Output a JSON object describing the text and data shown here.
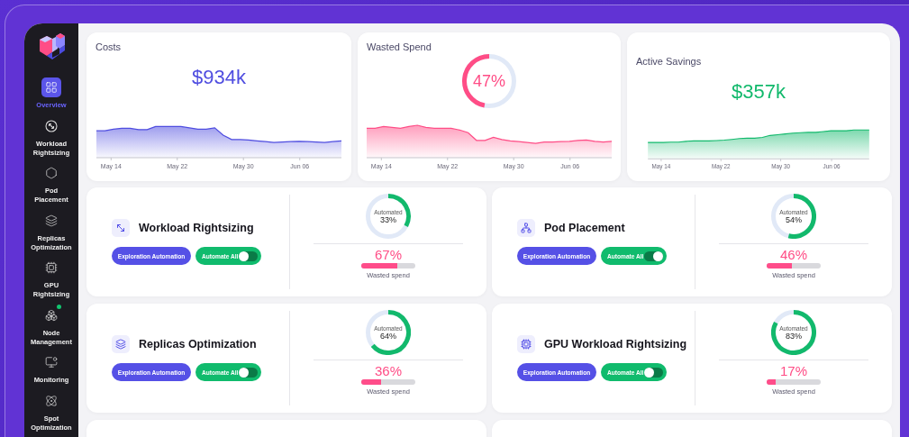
{
  "sidebar": {
    "items": [
      {
        "kind": "overview",
        "label": "Overview",
        "selected": true,
        "alert": false
      },
      {
        "kind": "rightsizing",
        "label": "Workload Rightsizing",
        "selected": false,
        "alert": false
      },
      {
        "kind": "placement",
        "label": "Pod Placement",
        "selected": false,
        "alert": false
      },
      {
        "kind": "replicas",
        "label": "Replicas Optimization",
        "selected": false,
        "alert": false
      },
      {
        "kind": "gpu",
        "label": "GPU Rightsizing",
        "selected": false,
        "alert": false
      },
      {
        "kind": "nodes",
        "label": "Node Management",
        "selected": false,
        "alert": true
      },
      {
        "kind": "monitoring",
        "label": "Monitoring",
        "selected": false,
        "alert": false
      },
      {
        "kind": "spot",
        "label": "Spot Optimization",
        "selected": false,
        "alert": false
      }
    ]
  },
  "summary": [
    {
      "kind": "amount",
      "title": "Costs",
      "value": "$934k",
      "color": "#4f4de0",
      "xticks": [
        "May 14",
        "May 22",
        "May 30",
        "Jun 06"
      ]
    },
    {
      "kind": "gauge",
      "title": "Wasted Spend",
      "value": "47%",
      "color": "#ff4d86",
      "xticks": [
        "May 14",
        "May 22",
        "May 30",
        "Jun 06"
      ]
    },
    {
      "kind": "amount",
      "title": "Active Savings",
      "value": "$357k",
      "color": "#12b96c",
      "xticks": [
        "May 14",
        "May 22",
        "May 30",
        "Jun 06"
      ]
    }
  ],
  "features": [
    {
      "kind": "rightsizing",
      "title": "Workload Rightsizing",
      "explore": "Exploration Automation",
      "automate": "Automate All",
      "automate_on": false,
      "automated": {
        "label": "Automated",
        "value": "33%"
      },
      "wasted": {
        "value": "67%",
        "level": 0.67,
        "label": "Wasted spend"
      }
    },
    {
      "kind": "placement",
      "title": "Pod Placement",
      "explore": "Exploration Automation",
      "automate": "Automate All",
      "automate_on": true,
      "automated": {
        "label": "Automated",
        "value": "54%"
      },
      "wasted": {
        "value": "46%",
        "level": 0.46,
        "label": "Wasted spend"
      }
    },
    {
      "kind": "replicas",
      "title": "Replicas Optimization",
      "explore": "Exploration Automation",
      "automate": "Automate All",
      "automate_on": false,
      "automated": {
        "label": "Automated",
        "value": "64%"
      },
      "wasted": {
        "value": "36%",
        "level": 0.36,
        "label": "Wasted spend"
      }
    },
    {
      "kind": "gpu",
      "title": "GPU Workload Rightsizing",
      "explore": "Exploration Automation",
      "automate": "Automate All",
      "automate_on": false,
      "automated": {
        "label": "Automated",
        "value": "83%"
      },
      "wasted": {
        "value": "17%",
        "level": 0.17,
        "label": "Wasted spend"
      }
    }
  ]
}
